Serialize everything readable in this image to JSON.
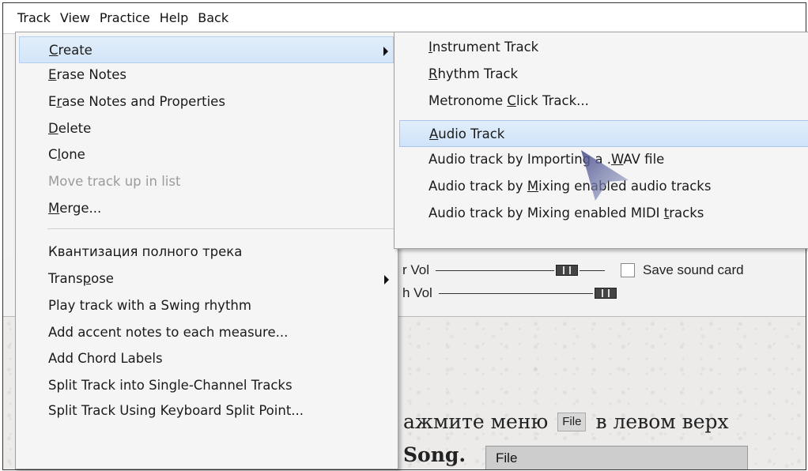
{
  "menubar": [
    "Track",
    "View",
    "Practice",
    "Help",
    "Back"
  ],
  "menu": {
    "items": [
      {
        "label": "Create",
        "u": 0,
        "submenu": true,
        "highlight": true
      },
      {
        "label": "Erase Notes",
        "u": 0
      },
      {
        "label": "Erase Notes and Properties",
        "u": 1
      },
      {
        "label": "Delete",
        "u": 0
      },
      {
        "label": "Clone",
        "u": 1
      },
      {
        "label": "Move track up in list",
        "disabled": true
      },
      {
        "label": "Merge...",
        "u": 0
      },
      {
        "label": "Квантизация полного трека"
      },
      {
        "label": "Transpose",
        "u": 5,
        "submenu": true
      },
      {
        "label": "Play track with a Swing rhythm"
      },
      {
        "label": "Add accent notes to each measure..."
      },
      {
        "label": "Add Chord Labels"
      },
      {
        "label": "Split Track into Single-Channel Tracks"
      },
      {
        "label": "Split Track Using Keyboard Split Point..."
      }
    ]
  },
  "submenu": {
    "items": [
      {
        "label": "Instrument Track",
        "u": 0
      },
      {
        "label": "Rhythm Track",
        "u": 0
      },
      {
        "label": "Metronome Click Track...",
        "u": 10
      },
      {
        "label": "Audio Track",
        "u": 0,
        "highlight": true
      },
      {
        "label": "Audio track by Importing a .WAV file",
        "u": 28
      },
      {
        "label": "Audio track by Mixing enabled audio tracks",
        "u": 15
      },
      {
        "label": "Audio track by Mixing enabled MIDI tracks",
        "u": 35
      }
    ]
  },
  "background": {
    "vol1_label": "r Vol",
    "vol2_label": "h Vol",
    "save_label": "Save sound card",
    "ru_text_1": "ажмите меню",
    "file_chip": "File",
    "ru_text_2": "в левом верх",
    "song_text": "Song.",
    "file_bar": "File"
  }
}
